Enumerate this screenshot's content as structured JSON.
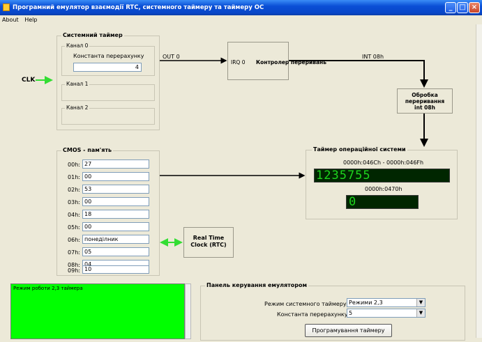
{
  "window": {
    "title": "Програмний емулятор взаємодії RTC, системного таймеру та таймеру ОС"
  },
  "menu": {
    "items": [
      "About",
      "Help"
    ]
  },
  "system_timer": {
    "title": "Системний таймер",
    "channel0": {
      "label": "Канал 0",
      "field_label": "Константа перерахунку",
      "value": "4"
    },
    "channel1": {
      "label": "Канал 1"
    },
    "channel2": {
      "label": "Канал 2"
    }
  },
  "clk_label": "CLK",
  "out0_label": "OUT 0",
  "irq0_label": "IRQ 0",
  "interrupt_controller_label": "Контролер переривань",
  "int08_label": "INT 08h",
  "int_handler_label": "Обробка переривання int 08h",
  "cmos": {
    "title": "CMOS - пам'ять",
    "rows": [
      {
        "addr": "00h:",
        "value": "27"
      },
      {
        "addr": "01h:",
        "value": "00"
      },
      {
        "addr": "02h:",
        "value": "53"
      },
      {
        "addr": "03h:",
        "value": "00"
      },
      {
        "addr": "04h:",
        "value": "18"
      },
      {
        "addr": "05h:",
        "value": "00"
      },
      {
        "addr": "06h:",
        "value": "понеділник"
      },
      {
        "addr": "07h:",
        "value": "05"
      },
      {
        "addr": "08h:",
        "value": "04"
      },
      {
        "addr": "09h:",
        "value": "10"
      }
    ]
  },
  "rtc_label": "Real Time Clock (RTC)",
  "os_timer": {
    "title": "Таймер операційної системи",
    "addr1": "0000h:046Ch - 0000h:046Fh",
    "value1": "1235755",
    "addr2": "0000h:0470h",
    "value2": "0"
  },
  "log": {
    "text": "Режим роботи 2,3 таймера"
  },
  "control_panel": {
    "title": "Панель керування емулятором",
    "mode_label": "Режим системного таймеру:",
    "mode_value": "Режими 2,3",
    "constant_label": "Константа перерахунку:",
    "constant_value": "5",
    "program_button": "Програмування таймеру"
  },
  "colors": {
    "lcd_text": "#1ed41e",
    "lcd_bg": "#002600",
    "log_bg": "#00ff00",
    "arrow_green": "#33dd33",
    "titlebar": "#0a4fd6"
  }
}
